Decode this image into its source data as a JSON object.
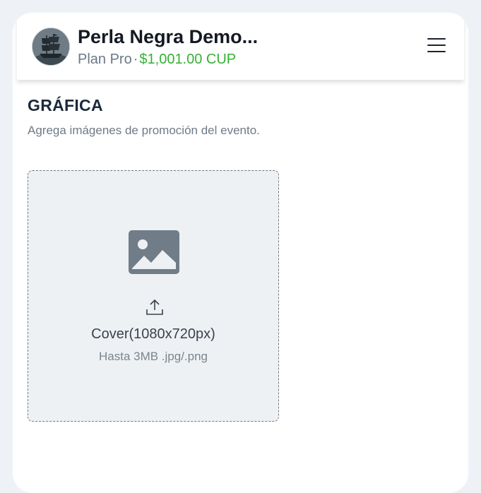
{
  "header": {
    "title": "Perla Negra Demo...",
    "plan": "Plan Pro",
    "separator": "·",
    "balance": "$1,001.00 CUP",
    "avatar_icon": "pirate-ship-avatar",
    "menu_icon": "hamburger-menu-icon"
  },
  "section": {
    "title": "GRÁFICA",
    "description": "Agrega imágenes de promoción del evento."
  },
  "upload": {
    "image_icon": "image-placeholder-icon",
    "upload_icon": "upload-icon",
    "label": "Cover(1080x720px)",
    "hint": "Hasta 3MB .jpg/.png"
  },
  "colors": {
    "balance": "#34b233",
    "title": "#141a22",
    "icon_gray": "#707c88"
  }
}
